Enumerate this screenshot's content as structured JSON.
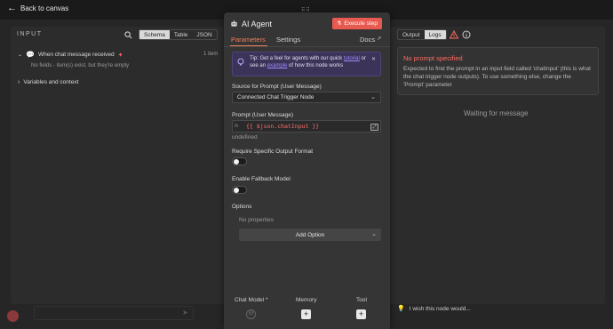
{
  "topbar": {
    "back_label": "Back to canvas"
  },
  "input_panel": {
    "header": "INPUT",
    "views": [
      "Schema",
      "Table",
      "JSON"
    ],
    "active_view": "Schema",
    "trigger": {
      "name": "When chat message received",
      "count": "1 item",
      "note": "No fields - item(s) exist, but they're empty"
    },
    "variables_label": "Variables and context"
  },
  "node": {
    "grip": "⠿⠿",
    "title": "AI Agent",
    "execute_label": "Execute step",
    "tabs": {
      "parameters": "Parameters",
      "settings": "Settings",
      "docs": "Docs"
    },
    "tip": {
      "text_a": "Tip: Get a feel for agents with our quick ",
      "link_a": "tutorial",
      "text_b": " or see an ",
      "link_b": "example",
      "text_c": " of how this node works"
    },
    "source_label": "Source for Prompt (User Message)",
    "source_value": "Connected Chat Trigger Node",
    "prompt_label": "Prompt (User Message)",
    "prompt_fx": "fx",
    "prompt_value": "{{ $json.chatInput }}",
    "prompt_result": "undefined",
    "require_format_label": "Require Specific Output Format",
    "require_format_on": false,
    "fallback_label": "Enable Fallback Model",
    "fallback_on": false,
    "options_label": "Options",
    "no_properties": "No properties",
    "add_option_label": "Add Option",
    "footer": {
      "chat_model": "Chat Model *",
      "memory": "Memory",
      "tool": "Tool"
    }
  },
  "output_panel": {
    "views": [
      "Output",
      "Logs"
    ],
    "active_view": "Logs",
    "error_title": "No prompt specified",
    "error_text": "Expected to find the prompt in an input field called 'chatInput' (this is what the chat trigger node outputs). To use something else, change the 'Prompt' parameter",
    "waiting": "Waiting for message",
    "wish_label": "I wish this node would..."
  },
  "colors": {
    "accent": "#f07f5a",
    "execute": "#e85a4f",
    "error": "#ff6b5f",
    "tip_bg": "#3c3358"
  }
}
